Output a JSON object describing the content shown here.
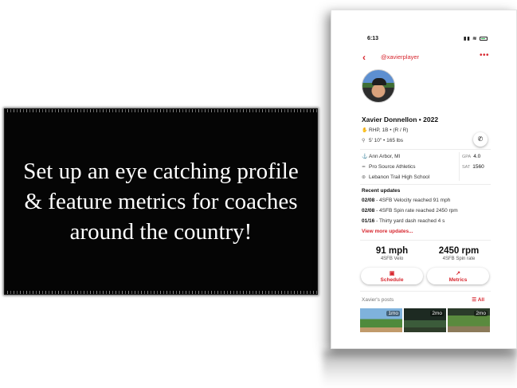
{
  "callout": {
    "text": "Set up an eye catching profile & feature metrics for coaches around the country!"
  },
  "status": {
    "time": "6:13"
  },
  "nav": {
    "handle": "@xavierplayer"
  },
  "profile": {
    "name": "Xavier Donnellon • 2022",
    "position": "RHP, 1B • (R / R)",
    "size": "5' 10\" • 165 lbs",
    "location": "Ann Arbor, MI",
    "club": "Pro Source Athletics",
    "school": "Lebanon Trail High School",
    "gpa_label": "GPA",
    "gpa_value": "4.0",
    "sat_label": "SAT",
    "sat_value": "1560"
  },
  "updates": {
    "title": "Recent updates",
    "items": [
      {
        "date": "02/08",
        "text": " - 4SFB Velocity reached 91 mph"
      },
      {
        "date": "02/08",
        "text": " - 4SFB Spin rate reached 2450 rpm"
      },
      {
        "date": "01/16",
        "text": " - Thirty yard dash reached 4 s"
      }
    ],
    "view_more": "View more updates..."
  },
  "stats": [
    {
      "value": "91 mph",
      "label": "4SFB Velo"
    },
    {
      "value": "2450 rpm",
      "label": "4SFB Spin rate"
    }
  ],
  "buttons": {
    "schedule": "Schedule",
    "metrics": "Metrics"
  },
  "posts": {
    "label": "Xavier's posts",
    "all": "All",
    "thumbs": [
      {
        "age": "1mo"
      },
      {
        "age": "2mo"
      },
      {
        "age": "2mo"
      }
    ]
  },
  "colors": {
    "accent": "#d7262e",
    "callout_bg": "#050505"
  },
  "icons": [
    "chevron-left-icon",
    "more-icon",
    "throwing-hand-icon",
    "person-icon",
    "phone-icon",
    "location-icon",
    "club-icon",
    "school-icon",
    "calendar-icon",
    "chart-icon",
    "filter-icon"
  ]
}
